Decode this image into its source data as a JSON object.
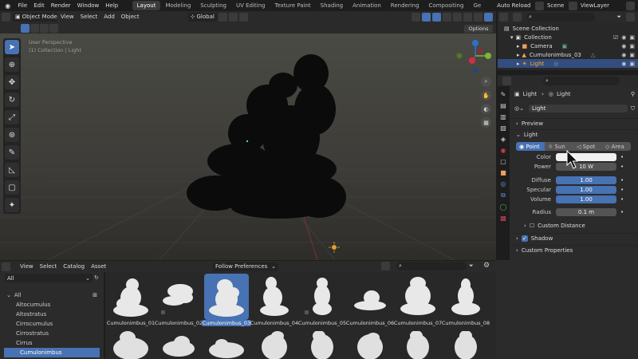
{
  "topbar": {
    "menus": [
      "File",
      "Edit",
      "Render",
      "Window",
      "Help"
    ],
    "workspaces": [
      "Layout",
      "Modeling",
      "Sculpting",
      "UV Editing",
      "Texture Paint",
      "Shading",
      "Animation",
      "Rendering",
      "Compositing",
      "Ge"
    ],
    "active_workspace": "Layout",
    "auto_reload": "Auto Reload",
    "scene": "Scene",
    "view_layer": "ViewLayer"
  },
  "viewport_header": {
    "mode": "Object Mode",
    "menus": [
      "View",
      "Select",
      "Add",
      "Object"
    ],
    "transform": "Global",
    "options": "Options"
  },
  "viewport": {
    "perspective": "User Perspective",
    "collection_info": "(1) Collection | Light"
  },
  "outliner": {
    "root": "Scene Collection",
    "items": [
      {
        "label": "Collection",
        "depth": 1,
        "selected": false
      },
      {
        "label": "Camera",
        "depth": 2,
        "selected": false
      },
      {
        "label": "Cumulonimbus_03",
        "depth": 2,
        "selected": false
      },
      {
        "label": "Light",
        "depth": 2,
        "selected": true
      }
    ]
  },
  "properties": {
    "breadcrumb_object": "Light",
    "breadcrumb_data": "Light",
    "datablock": "Light",
    "panels": {
      "preview": "Preview",
      "light": "Light",
      "custom_distance": "Custom Distance",
      "shadow": "Shadow",
      "custom_properties": "Custom Properties"
    },
    "light_types": [
      "Point",
      "Sun",
      "Spot",
      "Area"
    ],
    "active_light_type": "Point",
    "fields": [
      {
        "label": "Color",
        "value": ""
      },
      {
        "label": "Power",
        "value": "10 W"
      },
      {
        "label": "Diffuse",
        "value": "1.00"
      },
      {
        "label": "Specular",
        "value": "1.00"
      },
      {
        "label": "Volume",
        "value": "1.00"
      },
      {
        "label": "Radius",
        "value": "0.1 m"
      }
    ]
  },
  "asset_browser": {
    "menus": [
      "View",
      "Select",
      "Catalog",
      "Asset"
    ],
    "import_method": "Follow Preferences",
    "library": "All",
    "catalog_root": "All",
    "catalogs": [
      "Altocumulus",
      "Altostratus",
      "Cirrocumulus",
      "Cirrostratus",
      "Cirrus",
      "Cumulonimbus"
    ],
    "selected_catalog": "Cumulonimbus",
    "assets": [
      "Cumulonimbus_01",
      "Cumulonimbus_02",
      "Cumulonimbus_03",
      "Cumulonimbus_04",
      "Cumulonimbus_05",
      "Cumulonimbus_06",
      "Cumulonimbus_07",
      "Cumulonimbus_08"
    ],
    "selected_asset": "Cumulonimbus_03"
  },
  "colors": {
    "accent": "#4772b3",
    "selected_text": "#ffaf29",
    "background": "#1d1d1d"
  }
}
